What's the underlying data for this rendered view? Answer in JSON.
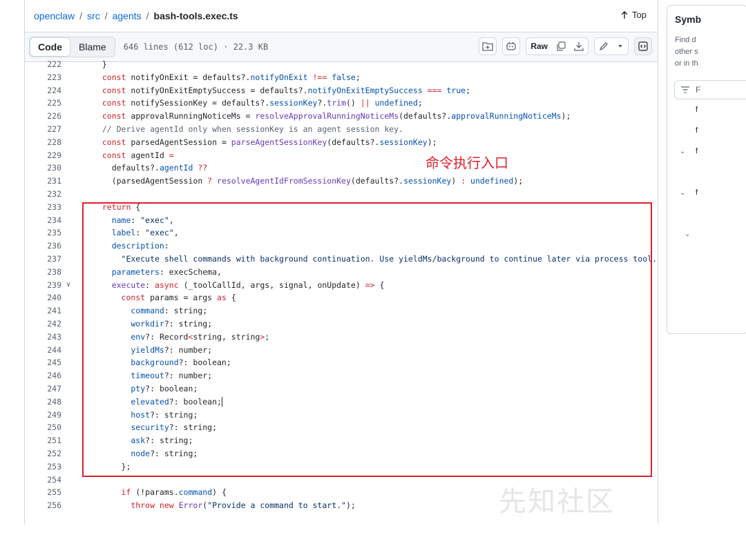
{
  "breadcrumb": {
    "repo": "openclaw",
    "sep": "/",
    "parts": [
      "src",
      "agents"
    ],
    "file": "bash-tools.exec.ts"
  },
  "top_link": "Top",
  "toolbar": {
    "code_tab": "Code",
    "blame_tab": "Blame",
    "file_info": "646 lines (612 loc) · 22.3 KB",
    "raw_label": "Raw"
  },
  "annotation": "命令执行入口",
  "watermark": "先知社区",
  "symbols": {
    "title": "Symb",
    "desc": "Find d\nother s\nor in th",
    "filter_label": "F",
    "items": [
      "f",
      "f",
      "f",
      "f"
    ]
  },
  "code_lines": [
    {
      "n": "222",
      "t": [
        [
          "tx",
          "  }"
        ]
      ]
    },
    {
      "n": "223",
      "t": [
        [
          "kw",
          "  const "
        ],
        [
          "tx",
          "notifyOnExit = defaults?."
        ],
        [
          "pr",
          "notifyOnExit"
        ],
        [
          "kw",
          " !== "
        ],
        [
          "pr",
          "false"
        ],
        [
          "tx",
          ";"
        ]
      ]
    },
    {
      "n": "224",
      "t": [
        [
          "kw",
          "  const "
        ],
        [
          "tx",
          "notifyOnExitEmptySuccess = defaults?."
        ],
        [
          "pr",
          "notifyOnExitEmptySuccess"
        ],
        [
          "kw",
          " === "
        ],
        [
          "pr",
          "true"
        ],
        [
          "tx",
          ";"
        ]
      ]
    },
    {
      "n": "225",
      "t": [
        [
          "kw",
          "  const "
        ],
        [
          "tx",
          "notifySessionKey = defaults?."
        ],
        [
          "pr",
          "sessionKey"
        ],
        [
          "tx",
          "?."
        ],
        [
          "fn",
          "trim"
        ],
        [
          "tx",
          "() "
        ],
        [
          "kw",
          "||"
        ],
        [
          "pr",
          " undefined"
        ],
        [
          "tx",
          ";"
        ]
      ]
    },
    {
      "n": "226",
      "t": [
        [
          "kw",
          "  const "
        ],
        [
          "tx",
          "approvalRunningNoticeMs = "
        ],
        [
          "fn",
          "resolveApprovalRunningNoticeMs"
        ],
        [
          "tx",
          "(defaults?."
        ],
        [
          "pr",
          "approvalRunningNoticeMs"
        ],
        [
          "tx",
          ");"
        ]
      ]
    },
    {
      "n": "227",
      "t": [
        [
          "cm",
          "  // Derive agentId only when sessionKey is an agent session key."
        ]
      ]
    },
    {
      "n": "228",
      "t": [
        [
          "kw",
          "  const "
        ],
        [
          "tx",
          "parsedAgentSession = "
        ],
        [
          "fn",
          "parseAgentSessionKey"
        ],
        [
          "tx",
          "(defaults?."
        ],
        [
          "pr",
          "sessionKey"
        ],
        [
          "tx",
          ");"
        ]
      ]
    },
    {
      "n": "229",
      "t": [
        [
          "kw",
          "  const "
        ],
        [
          "tx",
          "agentId "
        ],
        [
          "kw",
          "="
        ]
      ]
    },
    {
      "n": "230",
      "t": [
        [
          "tx",
          "    defaults?."
        ],
        [
          "pr",
          "agentId"
        ],
        [
          "kw",
          " ??"
        ]
      ]
    },
    {
      "n": "231",
      "t": [
        [
          "tx",
          "    (parsedAgentSession "
        ],
        [
          "kw",
          "?"
        ],
        [
          "fn",
          " resolveAgentIdFromSessionKey"
        ],
        [
          "tx",
          "(defaults?."
        ],
        [
          "pr",
          "sessionKey"
        ],
        [
          "tx",
          ") "
        ],
        [
          "kw",
          ":"
        ],
        [
          "pr",
          " undefined"
        ],
        [
          "tx",
          ");"
        ]
      ]
    },
    {
      "n": "232",
      "t": [
        [
          "tx",
          ""
        ]
      ]
    },
    {
      "n": "233",
      "t": [
        [
          "kw",
          "  return "
        ],
        [
          "tx",
          "{"
        ]
      ]
    },
    {
      "n": "234",
      "t": [
        [
          "pr",
          "    name"
        ],
        [
          "tx",
          ": "
        ],
        [
          "st",
          "\"exec\""
        ],
        [
          "tx",
          ","
        ]
      ]
    },
    {
      "n": "235",
      "t": [
        [
          "pr",
          "    label"
        ],
        [
          "tx",
          ": "
        ],
        [
          "st",
          "\"exec\""
        ],
        [
          "tx",
          ","
        ]
      ]
    },
    {
      "n": "236",
      "t": [
        [
          "pr",
          "    description"
        ],
        [
          "tx",
          ":"
        ]
      ]
    },
    {
      "n": "237",
      "t": [
        [
          "st",
          "      \"Execute shell commands with background continuation. Use yieldMs/background to continue later via process tool. Use"
        ]
      ]
    },
    {
      "n": "238",
      "t": [
        [
          "pr",
          "    parameters"
        ],
        [
          "tx",
          ": execSchema,"
        ]
      ]
    },
    {
      "n": "239",
      "fold": true,
      "t": [
        [
          "fn",
          "    execute"
        ],
        [
          "tx",
          ": "
        ],
        [
          "kw",
          "async "
        ],
        [
          "tx",
          "(_toolCallId, args, signal, onUpdate) "
        ],
        [
          "kw",
          "=> "
        ],
        [
          "tx",
          "{"
        ]
      ]
    },
    {
      "n": "240",
      "t": [
        [
          "kw",
          "      const "
        ],
        [
          "tx",
          "params = args "
        ],
        [
          "kw",
          "as "
        ],
        [
          "tx",
          "{"
        ]
      ]
    },
    {
      "n": "241",
      "t": [
        [
          "pr",
          "        command"
        ],
        [
          "tx",
          ": string;"
        ]
      ]
    },
    {
      "n": "242",
      "t": [
        [
          "pr",
          "        workdir"
        ],
        [
          "tx",
          "?: string;"
        ]
      ]
    },
    {
      "n": "243",
      "t": [
        [
          "pr",
          "        env"
        ],
        [
          "tx",
          "?: Record"
        ],
        [
          "kw",
          "<"
        ],
        [
          "tx",
          "string, string"
        ],
        [
          "kw",
          ">"
        ],
        [
          "tx",
          ";"
        ]
      ]
    },
    {
      "n": "244",
      "t": [
        [
          "pr",
          "        yieldMs"
        ],
        [
          "tx",
          "?: number;"
        ]
      ]
    },
    {
      "n": "245",
      "t": [
        [
          "pr",
          "        background"
        ],
        [
          "tx",
          "?: boolean;"
        ]
      ]
    },
    {
      "n": "246",
      "t": [
        [
          "pr",
          "        timeout"
        ],
        [
          "tx",
          "?: number;"
        ]
      ]
    },
    {
      "n": "247",
      "t": [
        [
          "pr",
          "        pty"
        ],
        [
          "tx",
          "?: boolean;"
        ]
      ]
    },
    {
      "n": "248",
      "cursor": true,
      "t": [
        [
          "pr",
          "        elevated"
        ],
        [
          "tx",
          "?: boolean;"
        ]
      ]
    },
    {
      "n": "249",
      "t": [
        [
          "pr",
          "        host"
        ],
        [
          "tx",
          "?: string;"
        ]
      ]
    },
    {
      "n": "250",
      "t": [
        [
          "pr",
          "        security"
        ],
        [
          "tx",
          "?: string;"
        ]
      ]
    },
    {
      "n": "251",
      "t": [
        [
          "pr",
          "        ask"
        ],
        [
          "tx",
          "?: string;"
        ]
      ]
    },
    {
      "n": "252",
      "t": [
        [
          "pr",
          "        node"
        ],
        [
          "tx",
          "?: string;"
        ]
      ]
    },
    {
      "n": "253",
      "t": [
        [
          "tx",
          "      };"
        ]
      ]
    },
    {
      "n": "254",
      "t": [
        [
          "tx",
          ""
        ]
      ]
    },
    {
      "n": "255",
      "t": [
        [
          "kw",
          "      if "
        ],
        [
          "tx",
          "(!params."
        ],
        [
          "pr",
          "command"
        ],
        [
          "tx",
          ") {"
        ]
      ]
    },
    {
      "n": "256",
      "t": [
        [
          "kw",
          "        throw new "
        ],
        [
          "fn",
          "Error"
        ],
        [
          "tx",
          "("
        ],
        [
          "st",
          "\"Provide a command to start.\""
        ],
        [
          "tx",
          ");"
        ]
      ]
    }
  ]
}
